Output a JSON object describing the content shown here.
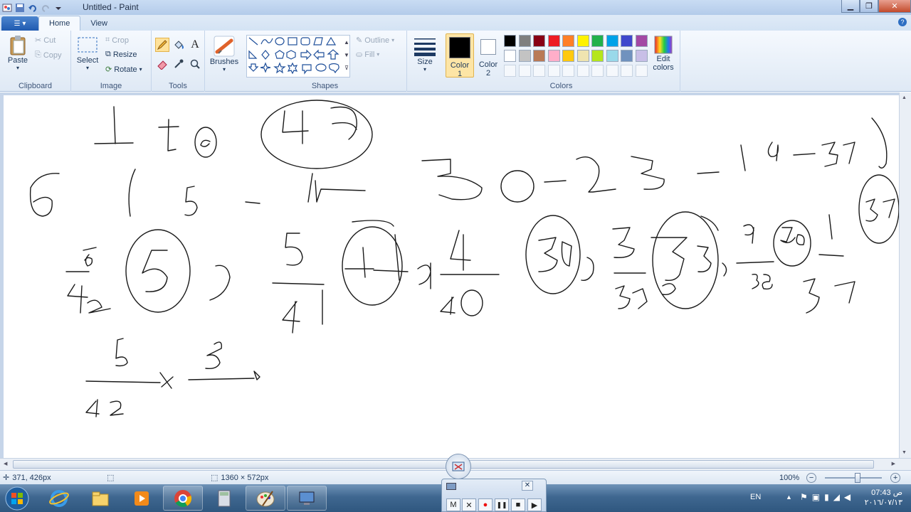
{
  "window": {
    "title": "Untitled - Paint"
  },
  "tabs": [
    {
      "label": "Home",
      "active": true
    },
    {
      "label": "View",
      "active": false
    }
  ],
  "ribbon": {
    "clipboard": {
      "label": "Clipboard",
      "paste": "Paste",
      "cut": "Cut",
      "copy": "Copy"
    },
    "image": {
      "label": "Image",
      "select": "Select",
      "crop": "Crop",
      "resize": "Resize",
      "rotate": "Rotate"
    },
    "tools": {
      "label": "Tools",
      "selected_tool": "pencil"
    },
    "brushes": {
      "label": "Brushes"
    },
    "shapes": {
      "label": "Shapes",
      "outline": "Outline",
      "fill": "Fill"
    },
    "size": {
      "label": "Size"
    },
    "colors": {
      "label": "Colors",
      "color1_label": "Color",
      "color1_num": "1",
      "color1_value": "#000000",
      "color2_label": "Color",
      "color2_num": "2",
      "color2_value": "#ffffff",
      "edit_label_1": "Edit",
      "edit_label_2": "colors",
      "palette_row1": [
        "#000000",
        "#7f7f7f",
        "#880015",
        "#ed1c24",
        "#ff7f27",
        "#fff200",
        "#22b14c",
        "#00a2e8",
        "#3f48cc",
        "#a349a4"
      ],
      "palette_row2": [
        "#ffffff",
        "#c3c3c3",
        "#b97a57",
        "#ffaec9",
        "#ffc90e",
        "#efe4b0",
        "#b5e61d",
        "#99d9ea",
        "#7092be",
        "#c8bfe7"
      ]
    }
  },
  "status": {
    "cursor_pos": "371, 426px",
    "canvas_size": "1360 × 572px",
    "zoom": "100%",
    "zoom_fraction": 0.58
  },
  "taskbar": {
    "lang": "EN",
    "time": "07:43 ص",
    "date": "٢٠١٦/٠٧/١٣"
  },
  "recorder": {
    "buttons": [
      "M",
      "✕",
      "●",
      "❚❚",
      "■",
      "▶"
    ]
  }
}
